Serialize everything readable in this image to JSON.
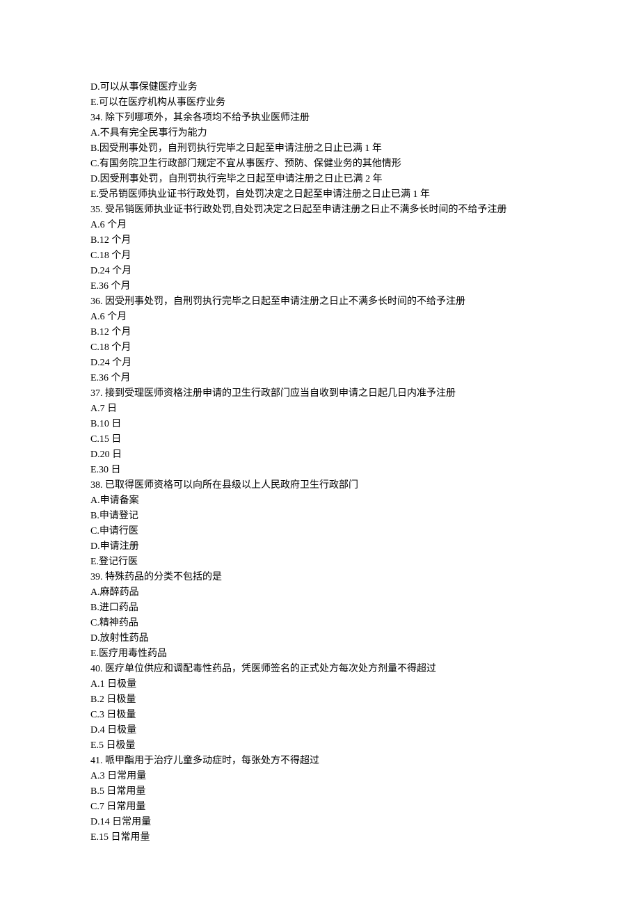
{
  "lines": [
    "D.可以从事保健医疗业务",
    "E.可以在医疗机构从事医疗业务",
    "34. 除下列哪项外，其余各项均不给予执业医师注册",
    "A.不具有完全民事行为能力",
    "B.因受刑事处罚，自刑罚执行完毕之日起至申请注册之日止已满 1 年",
    "C.有国务院卫生行政部门规定不宜从事医疗、预防、保健业务的其他情形",
    "D.因受刑事处罚，自刑罚执行完毕之日起至申请注册之日止已满 2 年",
    "E.受吊销医师执业证书行政处罚，自处罚决定之日起至申请注册之日止已满 1 年",
    "35. 受吊销医师执业证书行政处罚,自处罚决定之日起至申请注册之日止不满多长时间的不给予注册",
    "A.6 个月",
    "B.12 个月",
    "C.18 个月",
    "D.24 个月",
    "E.36 个月",
    "36. 因受刑事处罚，自刑罚执行完毕之日起至申请注册之日止不满多长时间的不给予注册",
    "A.6 个月",
    "B.12 个月",
    "C.18 个月",
    "D.24 个月",
    "E.36 个月",
    "37. 接到受理医师资格注册申请的卫生行政部门应当自收到申请之日起几日内准予注册",
    "A.7 日",
    "B.10 日",
    "C.15 日",
    "D.20 日",
    "E.30 日",
    "38. 已取得医师资格可以向所在县级以上人民政府卫生行政部门",
    "A.申请备案",
    "B.申请登记",
    "C.申请行医",
    "D.申请注册",
    "E.登记行医",
    "39. 特殊药品的分类不包括的是",
    "A.麻醉药品",
    "B.进口药品",
    "C.精神药品",
    "D.放射性药品",
    "E.医疗用毒性药品",
    "40. 医疗单位供应和调配毒性药品，凭医师签名的正式处方每次处方剂量不得超过",
    "A.1 日极量",
    "B.2 日极量",
    "C.3 日极量",
    "D.4 日极量",
    "E.5 日极量",
    "41. 哌甲酯用于治疗儿童多动症时，每张处方不得超过",
    "A.3 日常用量",
    "B.5 日常用量",
    "C.7 日常用量",
    "D.14 日常用量",
    "E.15 日常用量"
  ]
}
